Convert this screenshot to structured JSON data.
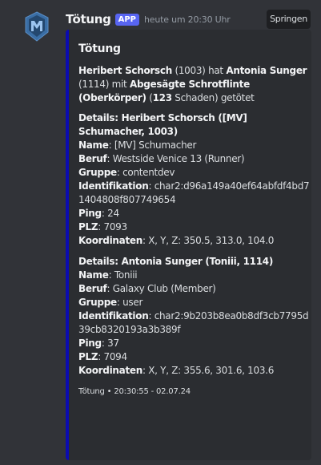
{
  "message": {
    "username": "Tötung",
    "badge": "APP",
    "timestamp": "heute um 20:30 Uhr",
    "jump_label": "Springen"
  },
  "embed": {
    "title": "Tötung",
    "description": {
      "killer": "Heribert Schorsch",
      "killer_id": " (1003) hat ",
      "victim": "Antonia Sunger",
      "victim_id": " (1114) mit ",
      "weapon": "Abgesägte Schrotflinte (Oberkörper)",
      "damage_open": " (",
      "damage": "123",
      "damage_close": " Schaden) getötet"
    },
    "fields": [
      {
        "name": "Details: Heribert Schorsch ([MV] Schumacher, 1003)",
        "rows": [
          {
            "label": "Name",
            "value": "[MV] Schumacher"
          },
          {
            "label": "Beruf",
            "value": "Westside Venice 13 (Runner)"
          },
          {
            "label": "Gruppe",
            "value": "contentdev"
          },
          {
            "label": "Identifikation",
            "value": "char2:d96a149a40ef64abfdf4bd71404808f807749654"
          },
          {
            "label": "Ping",
            "value": "24"
          },
          {
            "label": "PLZ",
            "value": "7093"
          },
          {
            "label": "Koordinaten",
            "value": "X, Y, Z: 350.5, 313.0, 104.0"
          }
        ]
      },
      {
        "name": "Details: Antonia Sunger (Toniii, 1114)",
        "rows": [
          {
            "label": "Name",
            "value": "Toniii"
          },
          {
            "label": "Beruf",
            "value": "Galaxy Club (Member)"
          },
          {
            "label": "Gruppe",
            "value": "user"
          },
          {
            "label": "Identifikation",
            "value": "char2:9b203b8ea0b8df3cb7795d39cb8320193a3b389f"
          },
          {
            "label": "Ping",
            "value": "37"
          },
          {
            "label": "PLZ",
            "value": "7094"
          },
          {
            "label": "Koordinaten",
            "value": "X, Y, Z: 355.6, 301.6, 103.6"
          }
        ]
      }
    ],
    "footer": "Tötung • 20:30:55 - 02.07.24",
    "color": "#0b0bb0"
  },
  "colors": {
    "background": "#313338",
    "embed_bg": "#2b2d31",
    "badge": "#5865f2"
  },
  "icons": {
    "avatar": "mv-logo-icon"
  }
}
